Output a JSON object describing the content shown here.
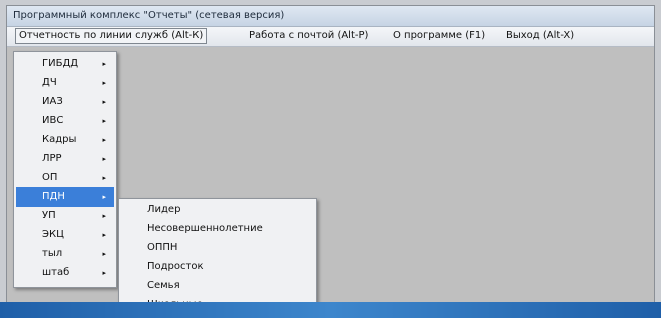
{
  "window": {
    "title": "Программный комплекс \"Отчеты\" (сетевая версия)"
  },
  "menubar": {
    "items": [
      {
        "label": "Отчетность по линии служб (Alt-К)"
      },
      {
        "label": "Работа с почтой (Alt-P)"
      },
      {
        "label": "О программе (F1)"
      },
      {
        "label": "Выход (Alt-X)"
      }
    ]
  },
  "submenu": {
    "items": [
      {
        "label": "ГИБДД"
      },
      {
        "label": "ДЧ"
      },
      {
        "label": "ИАЗ"
      },
      {
        "label": "ИВС"
      },
      {
        "label": "Кадры"
      },
      {
        "label": "ЛРР"
      },
      {
        "label": "ОП"
      },
      {
        "label": "ПДН"
      },
      {
        "label": "УП"
      },
      {
        "label": "ЭКЦ"
      },
      {
        "label": "тыл"
      },
      {
        "label": "штаб"
      }
    ],
    "highlighted_index": 7,
    "arrow_glyph": "▸"
  },
  "popup": {
    "items": [
      {
        "label": "Лидер"
      },
      {
        "label": "Несовершеннолетние"
      },
      {
        "label": "ОППН"
      },
      {
        "label": "Подросток"
      },
      {
        "label": "Семья"
      },
      {
        "label": "Школьные"
      }
    ]
  },
  "colors": {
    "highlight": "#3b7fd9",
    "client": "#bfbfbf",
    "menu_bg": "#f0f1f3"
  }
}
